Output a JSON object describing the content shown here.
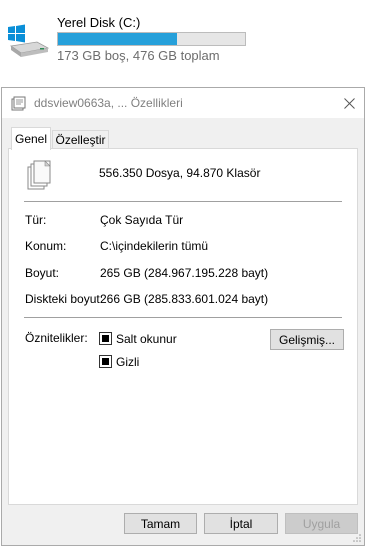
{
  "drive": {
    "name": "Yerel Disk (C:)",
    "usage_fraction": 0.636,
    "caption": "173 GB boş, 476 GB toplam",
    "icon": "windows-drive-icon",
    "bar_color": "#26a0da"
  },
  "dialog": {
    "title": "ddsview0663a, ... Özellikleri",
    "title_icon": "properties-icon",
    "close_icon": "close-icon",
    "tabs": [
      {
        "label": "Genel",
        "active": true
      },
      {
        "label": "Özelleştir",
        "active": false
      }
    ],
    "summary": "556.350 Dosya, 94.870 Klasör",
    "summary_icon": "multiple-files-icon",
    "rows": [
      {
        "label": "Tür:",
        "value": "Çok Sayıda Tür"
      },
      {
        "label": "Konum:",
        "value": "C:\\içindekilerin tümü"
      },
      {
        "label": "Boyut:",
        "value": "265 GB (284.967.195.228 bayt)"
      },
      {
        "label": "Diskteki boyut:",
        "value": "266 GB (285.833.601.024 bayt)"
      }
    ],
    "attributes": {
      "label": "Öznitelikler:",
      "readonly_label": "Salt okunur",
      "readonly_state": "indeterminate",
      "hidden_label": "Gizli",
      "hidden_state": "indeterminate",
      "advanced_button": "Gelişmiş..."
    },
    "buttons": {
      "ok": "Tamam",
      "cancel": "İptal",
      "apply": "Uygula"
    }
  }
}
